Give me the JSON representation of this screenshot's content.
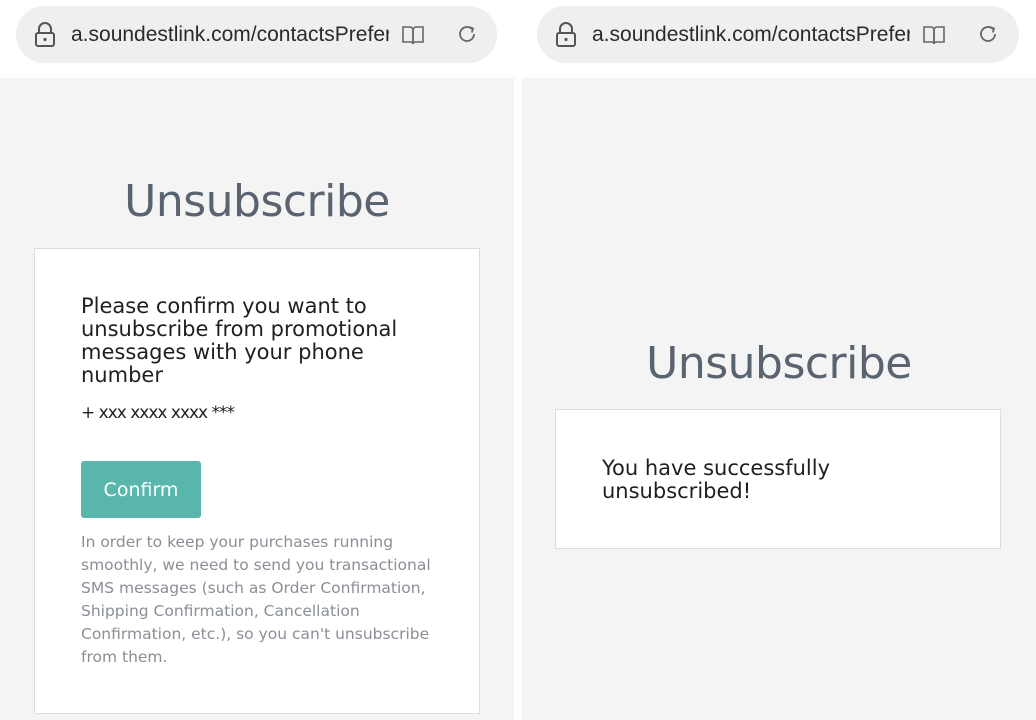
{
  "left": {
    "url": "a.soundestlink.com/contactsPreferences",
    "title": "Unsubscribe",
    "confirm_message": "Please confirm you want to unsubscribe from promotional messages with your phone number",
    "phone": "+ xxx xxxx xxxx ***",
    "confirm_label": "Confirm",
    "note": "In order to keep your purchases running smoothly, we need to send you transactional SMS messages (such as Order Confirmation, Shipping Confirmation, Cancellation Confirmation, etc.), so you can't unsubscribe from them."
  },
  "right": {
    "url": "a.soundestlink.com/contactsPreferences",
    "title": "Unsubscribe",
    "success_message": "You have successfully unsubscribed!"
  },
  "icons": {
    "lock": "lock-icon",
    "reader": "book-icon",
    "reload": "reload-icon"
  },
  "colors": {
    "button": "#59b6ad",
    "title": "#5a6370",
    "note": "#8a8f96",
    "page_bg": "#f4f4f4",
    "urlbar_bg": "#efefef"
  }
}
